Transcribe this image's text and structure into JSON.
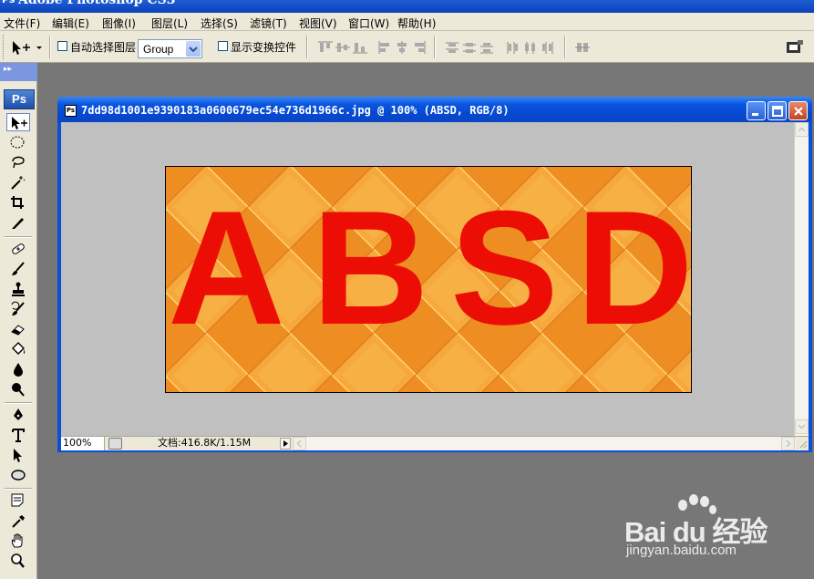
{
  "app": {
    "title": "Adobe Photoshop CS3",
    "logo": "Ps"
  },
  "menu": [
    "文件(F)",
    "编辑(E)",
    "图像(I)",
    "图层(L)",
    "选择(S)",
    "滤镜(T)",
    "视图(V)",
    "窗口(W)",
    "帮助(H)"
  ],
  "options": {
    "auto_select_label": "自动选择图层",
    "auto_select_checked": false,
    "group_select_value": "Group",
    "show_transform_label": "显示变换控件",
    "show_transform_checked": false
  },
  "tools": [
    "move-tool-icon",
    "marquee-tool-icon",
    "lasso-tool-icon",
    "magic-wand-tool-icon",
    "crop-tool-icon",
    "slice-tool-icon",
    "healing-brush-tool-icon",
    "brush-tool-icon",
    "clone-stamp-tool-icon",
    "history-brush-tool-icon",
    "eraser-tool-icon",
    "paint-bucket-tool-icon",
    "blur-tool-icon",
    "dodge-tool-icon",
    "pen-tool-icon",
    "type-tool-icon",
    "path-selection-tool-icon",
    "ellipse-tool-icon",
    "notes-tool-icon",
    "eyedropper-tool-icon",
    "hand-tool-icon",
    "zoom-tool-icon"
  ],
  "document": {
    "title": "7dd98d1001e9390183a0600679ec54e736d1966c.jpg @ 100% (ABSD, RGB/8)",
    "zoom": "100%",
    "info": "文档:416.8K/1.15M",
    "image_text": [
      "A",
      "B",
      "S",
      "D"
    ],
    "text_color": "#ec0d05",
    "background_color": "#f29a2a"
  },
  "watermark": {
    "brand": "Bai du 经验",
    "url": "jingyan.baidu.com"
  }
}
